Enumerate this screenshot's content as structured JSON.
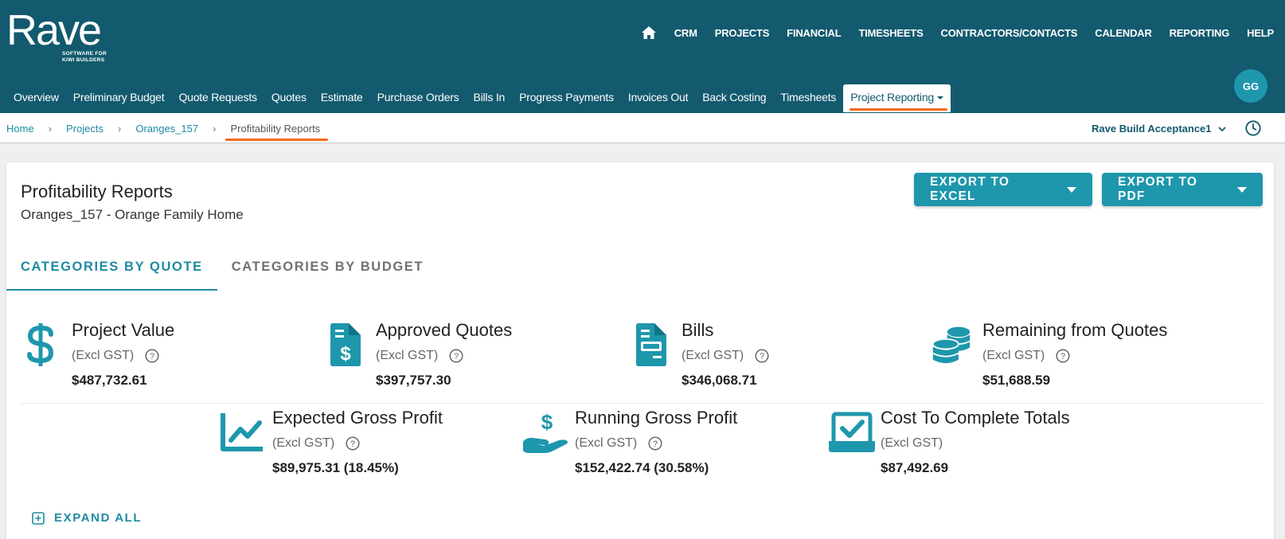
{
  "logo": {
    "word": "Rave",
    "tagline_line1": "SOFTWARE FOR",
    "tagline_line2": "KIWI BUILDERS"
  },
  "main_nav": [
    {
      "label": "CRM"
    },
    {
      "label": "PROJECTS"
    },
    {
      "label": "FINANCIAL"
    },
    {
      "label": "TIMESHEETS"
    },
    {
      "label": "CONTRACTORS/CONTACTS"
    },
    {
      "label": "CALENDAR"
    },
    {
      "label": "REPORTING"
    },
    {
      "label": "HELP"
    }
  ],
  "avatar_initials": "GG",
  "sub_nav": [
    {
      "label": "Overview"
    },
    {
      "label": "Preliminary Budget"
    },
    {
      "label": "Quote Requests"
    },
    {
      "label": "Quotes"
    },
    {
      "label": "Estimate"
    },
    {
      "label": "Purchase Orders"
    },
    {
      "label": "Bills In"
    },
    {
      "label": "Progress Payments"
    },
    {
      "label": "Invoices Out"
    },
    {
      "label": "Back Costing"
    },
    {
      "label": "Timesheets"
    },
    {
      "label": "Project Reporting"
    }
  ],
  "breadcrumb": [
    "Home",
    "Projects",
    "Oranges_157",
    "Profitability Reports"
  ],
  "company_selector": "Rave Build Acceptance1",
  "page": {
    "title": "Profitability Reports",
    "subtitle": "Oranges_157 - Orange Family Home",
    "export_excel": "EXPORT TO EXCEL",
    "export_pdf": "EXPORT TO PDF"
  },
  "report_tabs": [
    "CATEGORIES BY QUOTE",
    "CATEGORIES BY BUDGET"
  ],
  "kpis": [
    {
      "title": "Project Value",
      "sub": "(Excl GST)",
      "value": "$487,732.61",
      "icon": "dollar-icon"
    },
    {
      "title": "Approved Quotes",
      "sub": "(Excl GST)",
      "value": "$397,757.30",
      "icon": "invoice-dollar-icon"
    },
    {
      "title": "Bills",
      "sub": "(Excl GST)",
      "value": "$346,068.71",
      "icon": "bill-document-icon"
    },
    {
      "title": "Remaining from Quotes",
      "sub": "(Excl GST)",
      "value": "$51,688.59",
      "icon": "coins-icon"
    },
    {
      "title": "Expected Gross Profit",
      "sub": "(Excl GST)",
      "value": "$89,975.31 (18.45%)",
      "icon": "line-chart-icon"
    },
    {
      "title": "Running Gross Profit",
      "sub": "(Excl GST)",
      "value": "$152,422.74 (30.58%)",
      "icon": "hand-dollar-icon"
    },
    {
      "title": "Cost To Complete Totals",
      "sub": "(Excl GST)",
      "value": "$87,492.69",
      "icon": "checkbox-tray-icon"
    }
  ],
  "expand_all": "EXPAND ALL",
  "colors": {
    "header": "#135a6e",
    "accent": "#1e97ad",
    "highlight": "#f26a1b"
  }
}
